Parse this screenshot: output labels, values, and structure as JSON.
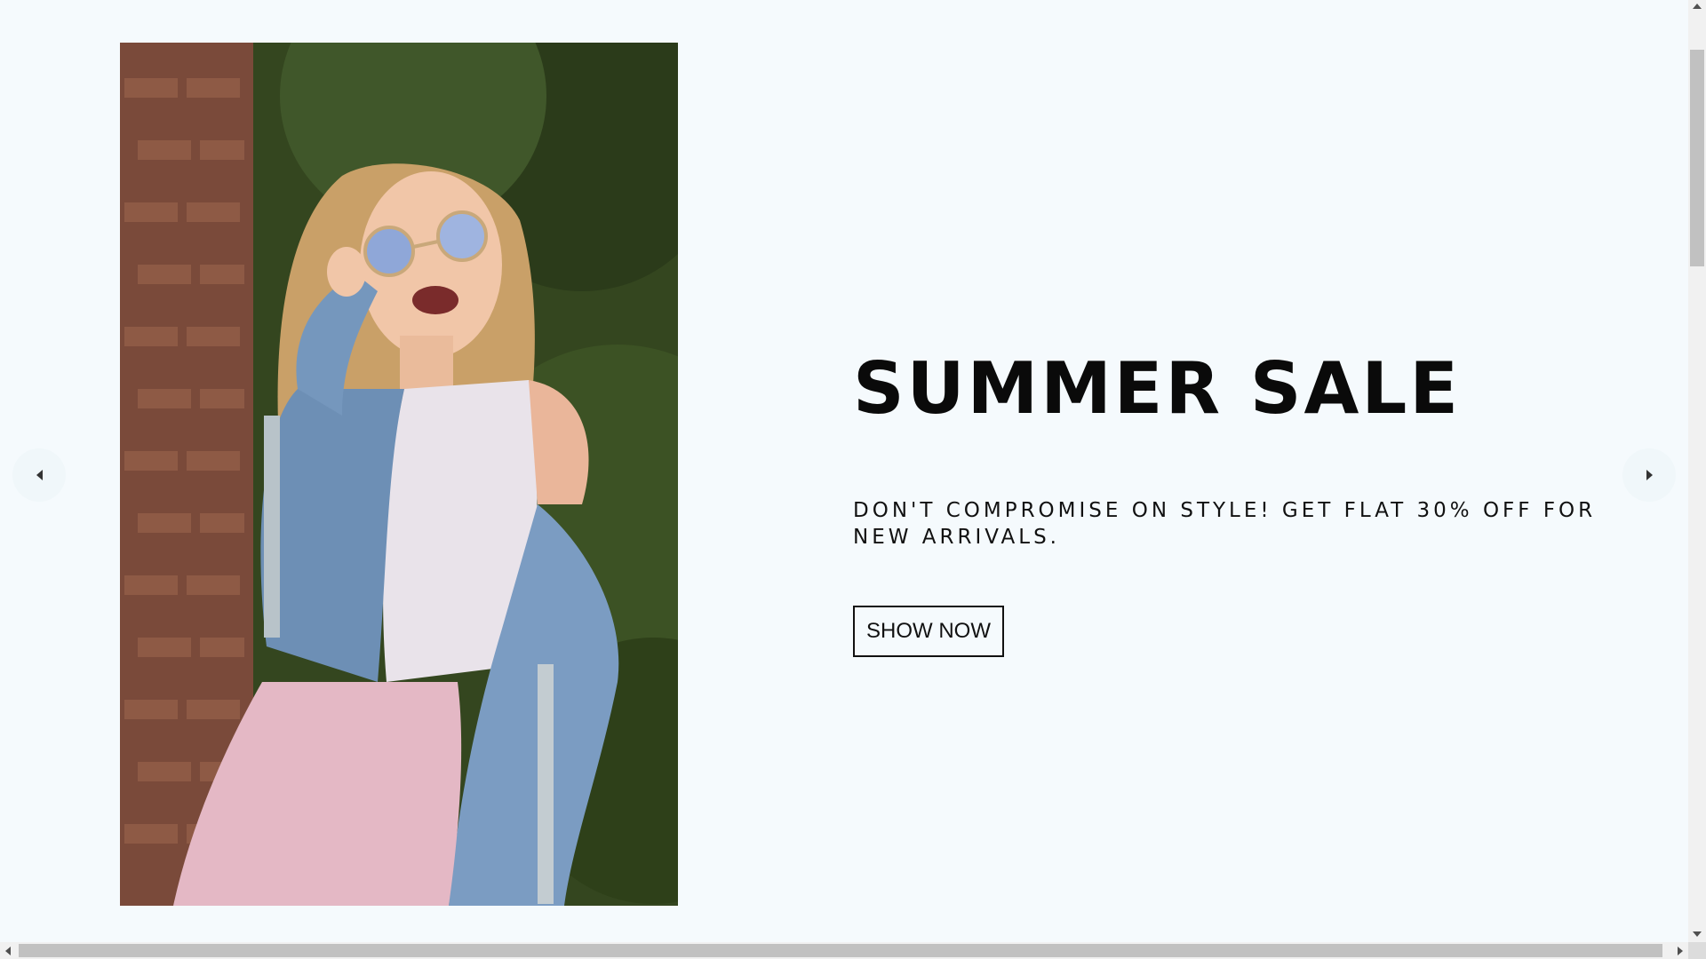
{
  "slider": {
    "title": "SUMMER SALE",
    "description": "DON'T COMPROMISE ON STYLE! GET FLAT 30% OFF FOR NEW ARRIVALS.",
    "button_label": "SHOW NOW",
    "image_icon": "woman-in-sunglasses-photo",
    "prev_icon": "arrow-left-icon",
    "next_icon": "arrow-right-icon",
    "background_color": "#f5fafd"
  }
}
